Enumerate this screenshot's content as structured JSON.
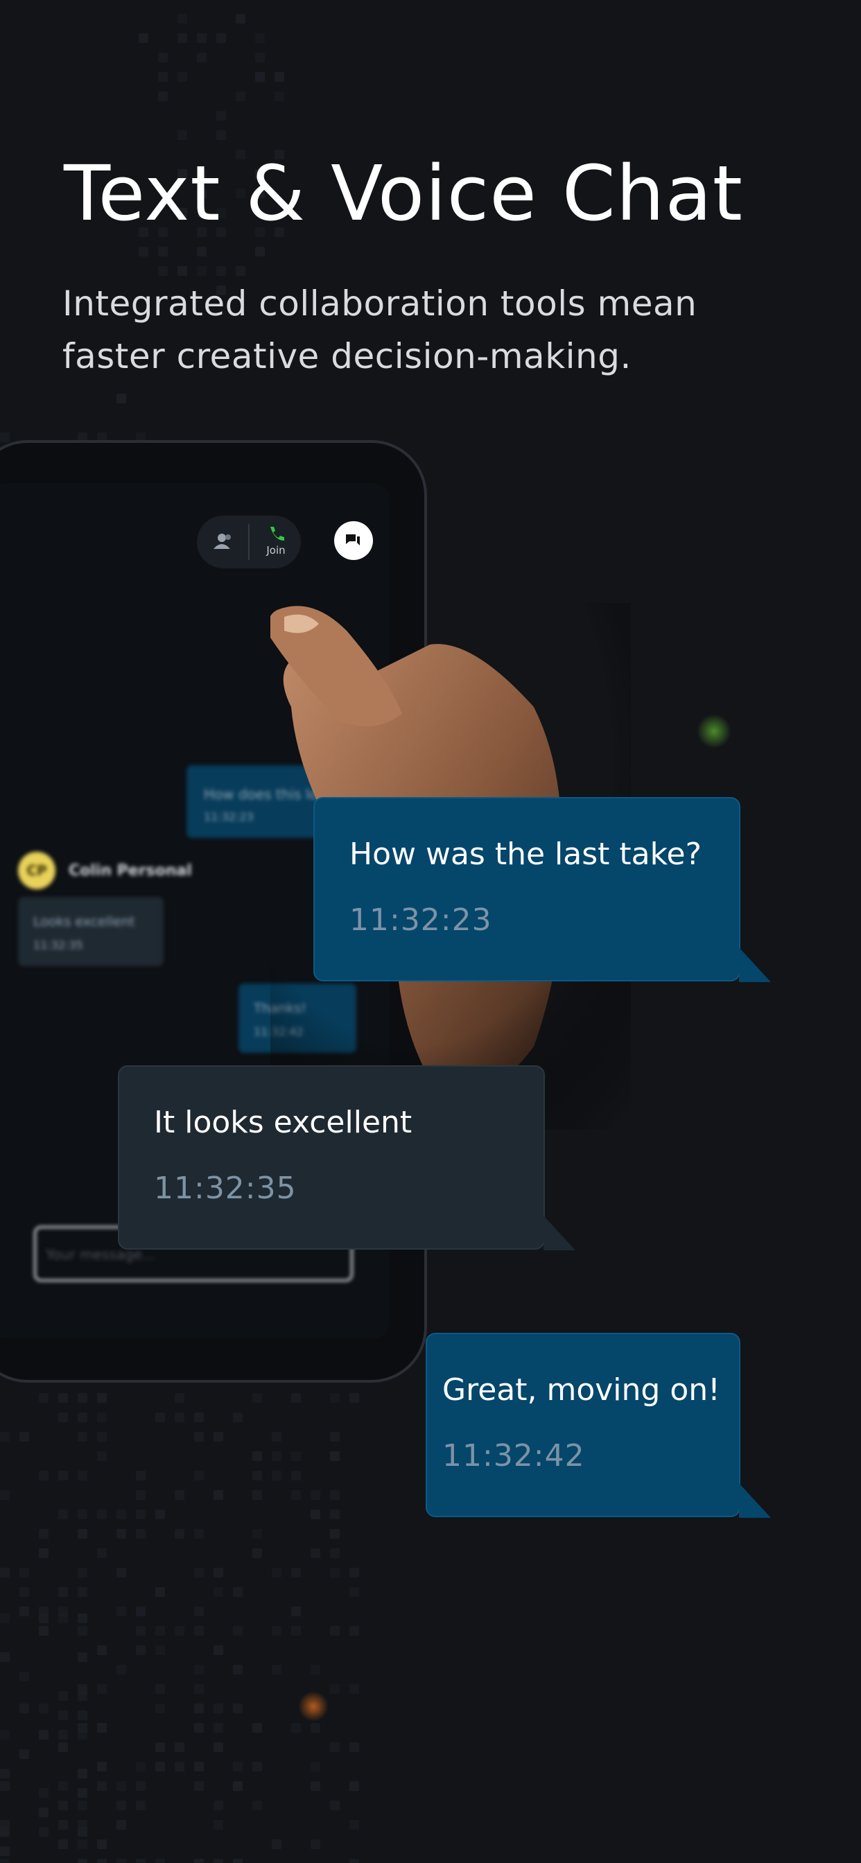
{
  "headline": "Text & Voice Chat",
  "subhead": "Integrated collaboration tools mean faster creative decision-making.",
  "tablet": {
    "join_label": "Join",
    "blurred_messages": [
      {
        "text": "How does this look?",
        "time": "11:32:23"
      },
      {
        "sender": "Colin Personal",
        "initials": "CP",
        "text": "Looks excellent",
        "time": "11:32:35"
      },
      {
        "text": "Thanks!",
        "time": "11:32:42"
      }
    ],
    "input_placeholder": "Your message..."
  },
  "bubbles": [
    {
      "text": "How was the last take?",
      "time": "11:32:23"
    },
    {
      "text": "It looks excellent",
      "time": "11:32:35"
    },
    {
      "text": "Great, moving on!",
      "time": "11:32:42"
    }
  ],
  "colors": {
    "background": "#121418",
    "blue_bubble": "#05466b",
    "dark_bubble": "#1f2931",
    "timestamp": "#7d93a6",
    "join_green": "#2ecc40",
    "avatar_yellow": "#e8d25a"
  },
  "icons": [
    "people-icon",
    "phone-icon",
    "chat-icon"
  ]
}
